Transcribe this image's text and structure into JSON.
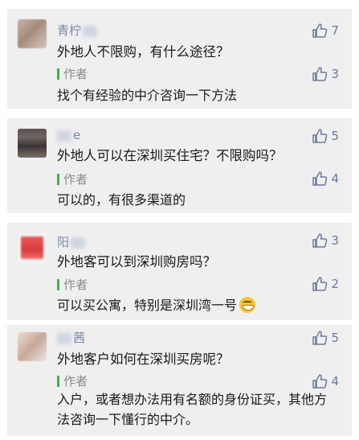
{
  "comments": [
    {
      "nickname": "青柠",
      "question": "外地人不限购，有什么途径？",
      "question_likes": "7",
      "author_label": "作者",
      "reply": "找个有经验的中介咨询一下方法",
      "reply_likes": "3"
    },
    {
      "nickname": "e",
      "question": "外地人可以在深圳买住宅？不限购吗？",
      "question_likes": "5",
      "author_label": "作者",
      "reply": "可以的，有很多渠道的",
      "reply_likes": "4"
    },
    {
      "nickname": "阳",
      "question": "外地客可以到深圳购房吗？",
      "question_likes": "3",
      "author_label": "作者",
      "reply": "可以买公寓，特别是深圳湾一号",
      "reply_likes": "2"
    },
    {
      "nickname": "茜",
      "question": "外地客户如何在深圳买房呢？",
      "question_likes": "5",
      "author_label": "作者",
      "reply": "入户，或者想办法用有名额的身份证买，其他方法咨询一下懂行的中介。",
      "reply_likes": "4"
    }
  ],
  "colors": {
    "card_bg": "#efefef",
    "nickname": "#7a88a6",
    "author_bar": "#3cb34a",
    "like": "#6a7a9c"
  },
  "icons": {
    "like": "thumbs-up-outline-icon",
    "emoji": "grinning-face-icon"
  }
}
